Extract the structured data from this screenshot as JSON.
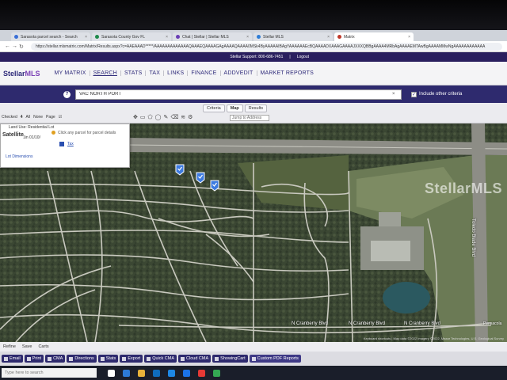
{
  "browser": {
    "tabs": [
      {
        "label": "Sarasota parcel search - Search",
        "active": false
      },
      {
        "label": "Sarasota County Gov FL",
        "active": false
      },
      {
        "label": "Chat | Stellar | Stellar MLS",
        "active": false
      },
      {
        "label": "Stellar MLS",
        "active": false
      },
      {
        "label": "Matrix",
        "active": true
      }
    ],
    "url": "https://stellar.mlsmatrix.com/Matrix/Results.aspx?c=AAEAAAD*****/AAAAAAAAAAAAAQAAAEQAAAAGAgAAAAQAAAA0MSk4ByAAAAAIBAgYAAAAAAEcBQAAAADXAAAGAAAAJXXXQBBgAAAA4MRbAgAAAAEMTAwBgAAAAMMwNgAAAAAAAAAAAA"
  },
  "header": {
    "support_text": "Stellar Support: 800-686-7451",
    "logout_label": "Logout",
    "logo_main": "Stellar",
    "logo_accent": "MLS",
    "nav": [
      "MY MATRIX",
      "SEARCH",
      "STATS",
      "TAX",
      "LINKS",
      "FINANCE",
      "ADDVEDIT",
      "MARKET REPORTS"
    ]
  },
  "search": {
    "value": "VAC NORTH PORT",
    "include_other_label": "Include other criteria"
  },
  "results": {
    "view_tabs": [
      "Criteria",
      "Map",
      "Results"
    ],
    "checked_label": "Checked",
    "checked_count": "4",
    "all_label": "All",
    "none_label": "None",
    "page_label": "Page",
    "jump_placeholder": "Jump to Address"
  },
  "popup": {
    "land_use": "Land Use: Residential Lot",
    "satellite": "Satellite",
    "date": "1in  01/10/",
    "parcel_hint": "Click any parcel for parcel details",
    "tax_label": "Tax",
    "lot_dims": "Lot Dimensions"
  },
  "map": {
    "watermark": "StellarMLS",
    "attribution": "Keyboard shortcuts | Map data ©2022 Imagery ©2022, Maxar Technologies, U.S. Geological Survey",
    "road_labels": [
      "N Cranberry Blvd",
      "N Cranberry Blvd",
      "N Cranberry Blvd",
      "Toledo Blade Blvd",
      "Pensacola"
    ],
    "colors": {
      "road": "#c9c9bf",
      "highway": "#9a9a94",
      "vegetation": "#3d4a34",
      "water": "#2d5a62",
      "marker": "#3d7be0"
    }
  },
  "lower_tabs": [
    "Refine",
    "Save",
    "Carts"
  ],
  "actions": [
    "Email",
    "Print",
    "CMA",
    "Directions",
    "Stats",
    "Export",
    "Quick CMA",
    "Cloud CMA",
    "ShowingCart",
    "Custom PDF Reports"
  ],
  "taskbar": {
    "search_placeholder": "Type here to search"
  }
}
